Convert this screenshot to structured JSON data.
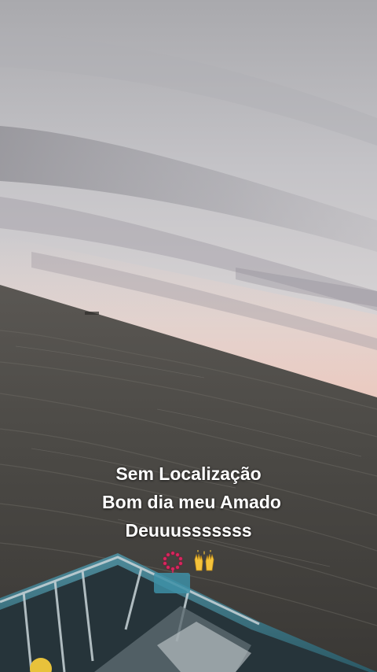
{
  "caption": {
    "line1": "Sem Localização",
    "line2": "Bom dia meu Amado",
    "line3": "Deuuusssssss",
    "emojis": [
      "prayer-beads-icon",
      "raised-hands-icon"
    ]
  },
  "colors": {
    "sky_top": "#b9b9bc",
    "sky_mid": "#d4d0d2",
    "horizon_glow": "#e8c9c0",
    "sea": "#4a4844",
    "boat_hull": "#3f7a8a",
    "text": "#ffffff"
  }
}
